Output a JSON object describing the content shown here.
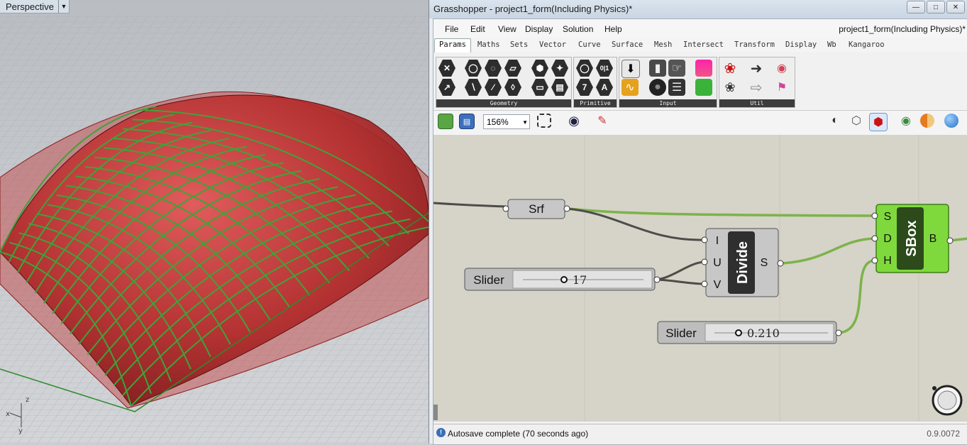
{
  "viewport": {
    "name": "Perspective",
    "axes": {
      "x": "x",
      "y": "y",
      "z": "z"
    }
  },
  "window": {
    "title": "Grasshopper - project1_form(Including Physics)*",
    "buttons": {
      "minimize": "—",
      "restore": "□",
      "close": "✕"
    }
  },
  "menu": {
    "items": [
      "File",
      "Edit",
      "View",
      "Display",
      "Solution",
      "Help"
    ],
    "document": "project1_form(Including Physics)*"
  },
  "tabs": [
    "Params",
    "Maths",
    "Sets",
    "Vector",
    "Curve",
    "Surface",
    "Mesh",
    "Intersect",
    "Transform",
    "Display",
    "Wb",
    "Kangaroo"
  ],
  "active_tab": "Params",
  "ribbon": {
    "groups": [
      "Geometry",
      "Primitive",
      "Input",
      "Util"
    ],
    "icons": {
      "geometry": [
        "point-icon",
        "circle-icon",
        "arc-icon",
        "curve-icon",
        "box-icon",
        "brep-icon",
        "vector-icon",
        "line-icon",
        "plane-icon",
        "circular-arc-icon",
        "surface-icon",
        "mesh-icon"
      ],
      "primitive": [
        "boolean-icon",
        "integer-icon",
        "number-icon",
        "text-icon"
      ],
      "primitive_glyphs": [
        "0|1",
        "7",
        "A"
      ],
      "input": [
        "panel-icon",
        "toggle-icon",
        "button-icon",
        "gradient-icon",
        "graph-icon",
        "value-list-icon",
        "matrix-icon",
        "colour-swatch-icon"
      ],
      "util": [
        "cherry-picker-icon",
        "relay-icon",
        "data-dam-icon",
        "jump-icon",
        "galapagos-icon",
        "timer-icon"
      ]
    }
  },
  "toolbar": {
    "zoom": "156%",
    "icons": [
      "open-file-icon",
      "save-file-icon",
      "zoom-extents-icon",
      "preview-eye-icon",
      "sketch-icon",
      "no-preview-icon",
      "wireframe-preview-icon",
      "shaded-preview-icon",
      "selected-preview-icon",
      "document-preview-icon",
      "preview-mesh-icon"
    ]
  },
  "canvas": {
    "nodes": {
      "srf": {
        "label": "Srf"
      },
      "slider1": {
        "label": "Slider",
        "value": "17"
      },
      "divide": {
        "label": "Divide",
        "inputs": [
          "I",
          "U",
          "V"
        ],
        "outputs": [
          "S"
        ]
      },
      "slider2": {
        "label": "Slider",
        "value": "0.210"
      },
      "sbox": {
        "label": "SBox",
        "inputs": [
          "S",
          "D",
          "H"
        ],
        "outputs": [
          "B"
        ]
      }
    },
    "colors": {
      "canvas": "#d6d3c8",
      "component": "#c7c7c7",
      "selected": "#7fd93c",
      "wire": "#4e4c48",
      "wire_selected": "#7cb34a"
    }
  },
  "status": {
    "message": "Autosave complete (70 seconds ago)",
    "version": "0.9.0072"
  }
}
